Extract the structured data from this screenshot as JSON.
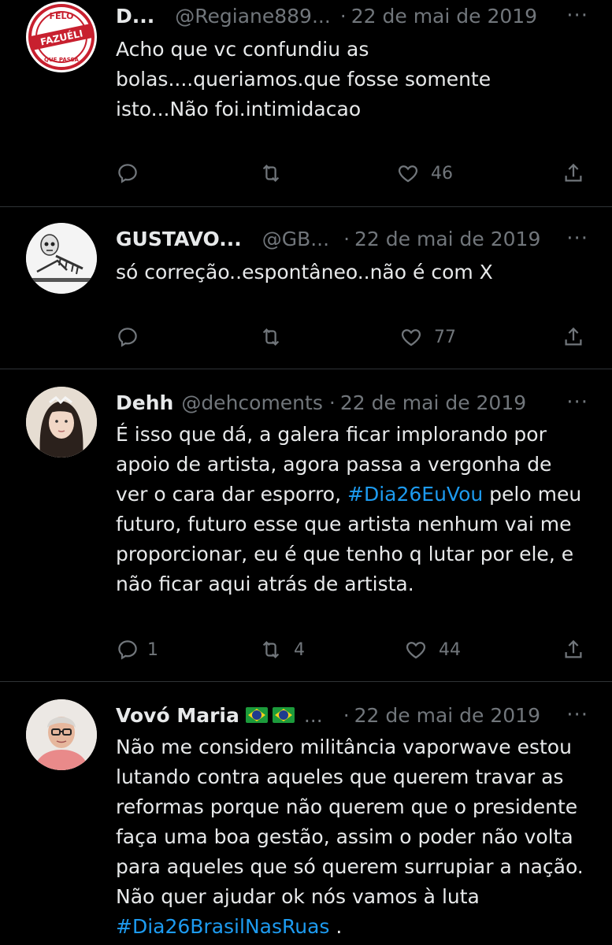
{
  "tweets": [
    {
      "name": "D...",
      "handle": "@Regiane889...",
      "dot": "·",
      "date": "22 de mai de 2019",
      "more": "···",
      "lines": [
        "Acho que vc confundiu as",
        "bolas....queriamos.que fosse somente",
        "isto...Não foi.intimidacao"
      ],
      "avatar_icon": "stamp-avatar",
      "avatar_text": [
        "FELO",
        "FAZUÉLI",
        "QUE PASSA"
      ],
      "replies": "",
      "retweets": "",
      "likes": "46"
    },
    {
      "name": "GUSTAVO...",
      "handle": "@GB...",
      "dot": "·",
      "date": "22 de mai de 2019",
      "more": "···",
      "lines": [
        "só correção..espontâneo..não é com X"
      ],
      "avatar_icon": "skeleton-avatar",
      "replies": "",
      "retweets": "",
      "likes": "77"
    },
    {
      "name": "Dehh",
      "handle": "@dehcoments",
      "dot": "·",
      "date": "22 de mai de 2019",
      "more": "···",
      "lines": [
        "É isso que dá, a galera ficar implorando por",
        "apoio de artista, agora passa a vergonha de",
        "ver o cara dar esporro, ",
        "futuro, futuro esse que artista nenhum vai me",
        "proporcionar, eu é que tenho q lutar por ele, e",
        "não ficar aqui atrás de artista."
      ],
      "line3_hashtag": "#Dia26EuVou",
      "line3_tail": " pelo meu",
      "avatar_icon": "woman-avatar",
      "replies": "1",
      "retweets": "4",
      "likes": "44"
    },
    {
      "name": "Vovó Maria",
      "name_suffix": "...",
      "handle": "",
      "dot": "·",
      "date": "22 de mai de 2019",
      "more": "···",
      "lines": [
        "Não me considero militância vaporwave estou",
        "lutando contra aqueles que querem travar as",
        "reformas porque não querem que o presidente",
        "faça uma boa gestão, assim o poder não volta",
        "para aqueles que só querem surrupiar a nação.",
        "Não quer ajudar ok nós vamos à luta"
      ],
      "last_hashtag": "#Dia26BrasilNasRuas",
      "last_tail": " .",
      "avatar_icon": "grandma-avatar",
      "flag_icons": [
        "brazil-flag-icon",
        "brazil-flag-icon"
      ]
    }
  ],
  "icons": {
    "reply": "reply-icon",
    "retweet": "retweet-icon",
    "like": "heart-icon",
    "share": "share-icon"
  },
  "colors": {
    "background": "#000000",
    "text": "#e7e9ea",
    "muted": "#71767b",
    "link": "#1d9bf0",
    "divider": "#2f3336"
  }
}
